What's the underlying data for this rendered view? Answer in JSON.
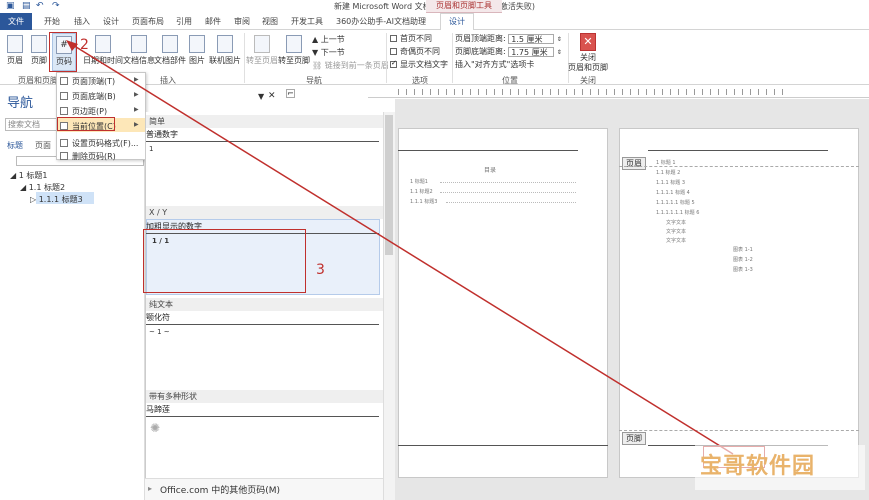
{
  "window": {
    "title": "新建 Microsoft Word 文档.docx - Word(产品激活失败)",
    "tools_tab_header": "页眉和页脚工具"
  },
  "tabs": [
    "开始",
    "插入",
    "设计",
    "页面布局",
    "引用",
    "邮件",
    "审阅",
    "视图",
    "开发工具",
    "360办公助手-AI文档助理"
  ],
  "tab_file": "文件",
  "tab_design": "设计",
  "ribbon": {
    "header_label": "页眉",
    "footer_label": "页脚",
    "pagenum_label": "页码",
    "date_label": "日期和时间",
    "docinfo_label": "文档信息",
    "parts_label": "文档部件",
    "picture_label": "图片",
    "online_picture_label": "联机图片",
    "goto_header_label": "转至页眉",
    "goto_footer_label": "转至页脚",
    "prev_section_label": "上一节",
    "next_section_label": "下一节",
    "link_prev_label": "链接到前一条页眉",
    "group_header_footer": "页眉和页脚",
    "group_insert": "插入",
    "group_nav": "导航",
    "group_options": "选项",
    "group_position": "位置",
    "group_close": "关闭",
    "opt_first_diff": "首页不同",
    "opt_odd_even": "奇偶页不同",
    "opt_show_text": "显示文档文字",
    "header_dist_label": "页眉顶端距离:",
    "header_dist_value": "1.5 厘米",
    "footer_dist_label": "页脚底端距离:",
    "footer_dist_value": "1.75 厘米",
    "insert_align_tab": "插入\"对齐方式\"选项卡",
    "close_label": "关闭\n页眉和页脚"
  },
  "nav": {
    "title": "导航",
    "search_placeholder": "搜索文档",
    "tab_headings": "标题",
    "tab_pages": "页面",
    "tree": [
      "1 标题1",
      "1.1 标题2",
      "1.1.1 标题3"
    ]
  },
  "dropdown": {
    "items": [
      "页面顶端(T)",
      "页面底端(B)",
      "页边距(P)",
      "当前位置(C)",
      "设置页码格式(F)...",
      "删除页码(R)"
    ]
  },
  "gallery": {
    "section_simple": "简单",
    "item_plain_number": "普通数字",
    "prev_plain": "1",
    "section_xy": "X / Y",
    "item_bold_number": "加粗显示的数字",
    "prev_bold": "1 / 1",
    "section_plain_text": "纯文本",
    "item_tilde": "颚化符",
    "prev_tilde": "~ 1 ~",
    "section_shapes": "带有多种形状",
    "item_horseshoe": "马蹄莲",
    "footer_link": "Office.com 中的其他页码(M)"
  },
  "doc": {
    "toc_title": "目录",
    "toc_lines": [
      "1 标题1",
      "1.1 标题2",
      "1.1.1 标题3"
    ],
    "headings": [
      "1 标题 1",
      "1.1 标题 2",
      "1.1.1 标题 3",
      "1.1.1.1 标题 4",
      "1.1.1.1.1 标题 5",
      "1.1.1.1.1.1 标题 6"
    ],
    "body_lines": [
      "文字文本",
      "文字文本",
      "文字文本"
    ],
    "figure_lines": [
      "图表 1-1",
      "图表 1-2",
      "图表 1-3"
    ],
    "header_tag": "页眉",
    "footer_tag": "页脚"
  },
  "annotations": {
    "n2": "2",
    "n3": "3"
  },
  "watermark": "宝哥软件园",
  "colors": {
    "accent": "#2b579a",
    "annotation": "#c0302d",
    "highlight": "#fde7b8"
  }
}
